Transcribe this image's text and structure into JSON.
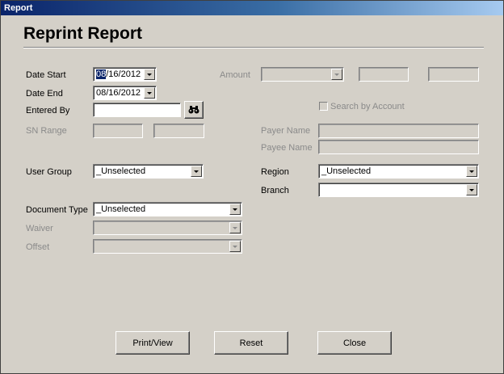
{
  "window": {
    "title": "Report"
  },
  "page": {
    "title": "Reprint Report"
  },
  "filters": {
    "date_start": {
      "label": "Date Start",
      "value_highlight": "08",
      "value_rest": "/16/2012"
    },
    "date_end": {
      "label": "Date End",
      "value": "08/16/2012"
    },
    "entered_by": {
      "label": "Entered By",
      "value": ""
    },
    "sn_range": {
      "label": "SN Range"
    },
    "user_group": {
      "label": "User Group",
      "value": "_Unselected"
    },
    "document_type": {
      "label": "Document Type",
      "value": "_Unselected"
    },
    "waiver": {
      "label": "Waiver",
      "value": ""
    },
    "offset": {
      "label": "Offset",
      "value": ""
    },
    "amount": {
      "label": "Amount"
    },
    "search_by_account": {
      "label": "Search by Account",
      "checked": false
    },
    "payer_name": {
      "label": "Payer Name",
      "value": ""
    },
    "payee_name": {
      "label": "Payee Name",
      "value": ""
    },
    "region": {
      "label": "Region",
      "value": "_Unselected"
    },
    "branch": {
      "label": "Branch",
      "value": ""
    }
  },
  "buttons": {
    "print_view": "Print/View",
    "reset": "Reset",
    "close": "Close"
  }
}
